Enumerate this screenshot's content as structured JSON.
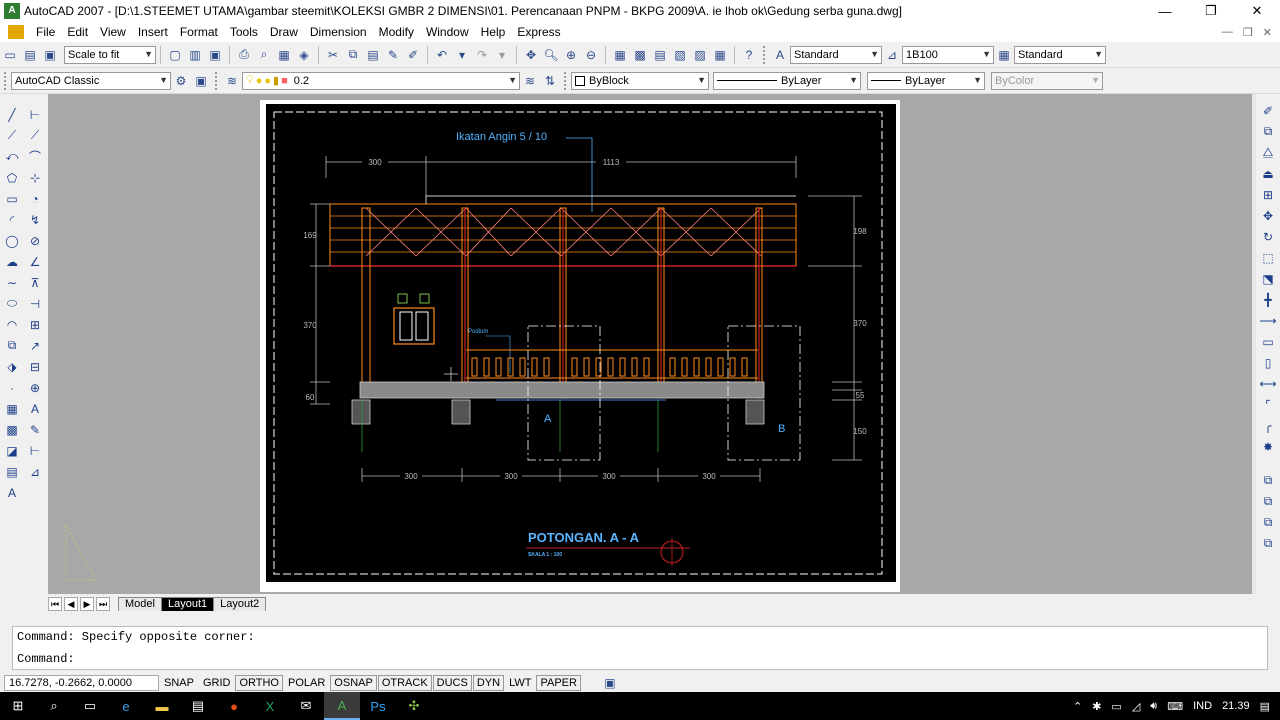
{
  "window": {
    "title": "AutoCAD 2007 - [D:\\1.STEEMET UTAMA\\gambar steemit\\KOLEKSI GMBR 2 DIMENSI\\01. Perencanaan PNPM - BKPG 2009\\A. ie lhob ok\\Gedung serba guna.dwg]",
    "app_icon": "A",
    "minimize": "—",
    "restore": "❐",
    "close": "✕"
  },
  "menu": {
    "items": [
      "File",
      "Edit",
      "View",
      "Insert",
      "Format",
      "Tools",
      "Draw",
      "Dimension",
      "Modify",
      "Window",
      "Help",
      "Express"
    ],
    "doc_min": "—",
    "doc_restore": "❐",
    "doc_close": "✕"
  },
  "toolbar1": {
    "scale_combo": "Scale to fit",
    "textstyle_combo": "Standard",
    "dimstyle_combo": "1B100",
    "tablestyle_combo": "Standard"
  },
  "toolbar2": {
    "workspace_combo": "AutoCAD Classic",
    "layer_combo": "0.2",
    "color_combo": "ByBlock",
    "linetype_combo": "ByLayer",
    "lineweight_combo": "ByLayer",
    "plotstyle_combo": "ByColor"
  },
  "drawing": {
    "callout_title": "Ikatan Angin  5 / 10",
    "dim_top_left": "300",
    "dim_top_total": "1113",
    "dim_left_top": "169",
    "dim_left_mid": "370",
    "dim_left_bottom": "60",
    "dim_right_top": "198",
    "dim_right_mid": "370",
    "dim_right_55": "55",
    "dim_right_150": "150",
    "dim_bottom_1": "300",
    "dim_bottom_2": "300",
    "dim_bottom_3": "300",
    "dim_bottom_4": "300",
    "podium_label": "Podium",
    "label_a": "A",
    "label_b": "B",
    "section_title": "POTONGAN. A - A",
    "scale_note": "SKALA  1 : 100"
  },
  "tabs": {
    "items": [
      "Model",
      "Layout1",
      "Layout2"
    ],
    "active": "Layout1"
  },
  "command": {
    "history": "Command: Specify opposite corner:",
    "prompt": "Command:"
  },
  "status": {
    "coordinates": "16.7278, -0.2662, 0.0000",
    "toggles": [
      "SNAP",
      "GRID",
      "ORTHO",
      "POLAR",
      "OSNAP",
      "OTRACK",
      "DUCS",
      "DYN",
      "LWT",
      "PAPER"
    ]
  },
  "taskbar": {
    "language": "IND",
    "time": "21.39"
  },
  "colors": {
    "sheet": "#000000",
    "paper": "#ffffff",
    "canvas": "#a8a8a8",
    "dimension": "#bbbbbb",
    "callout": "#4fb3ff",
    "title_text": "#5ab4ff",
    "orange": "#ff8c1a",
    "red": "#cc2222",
    "pink": "#ff8080"
  }
}
